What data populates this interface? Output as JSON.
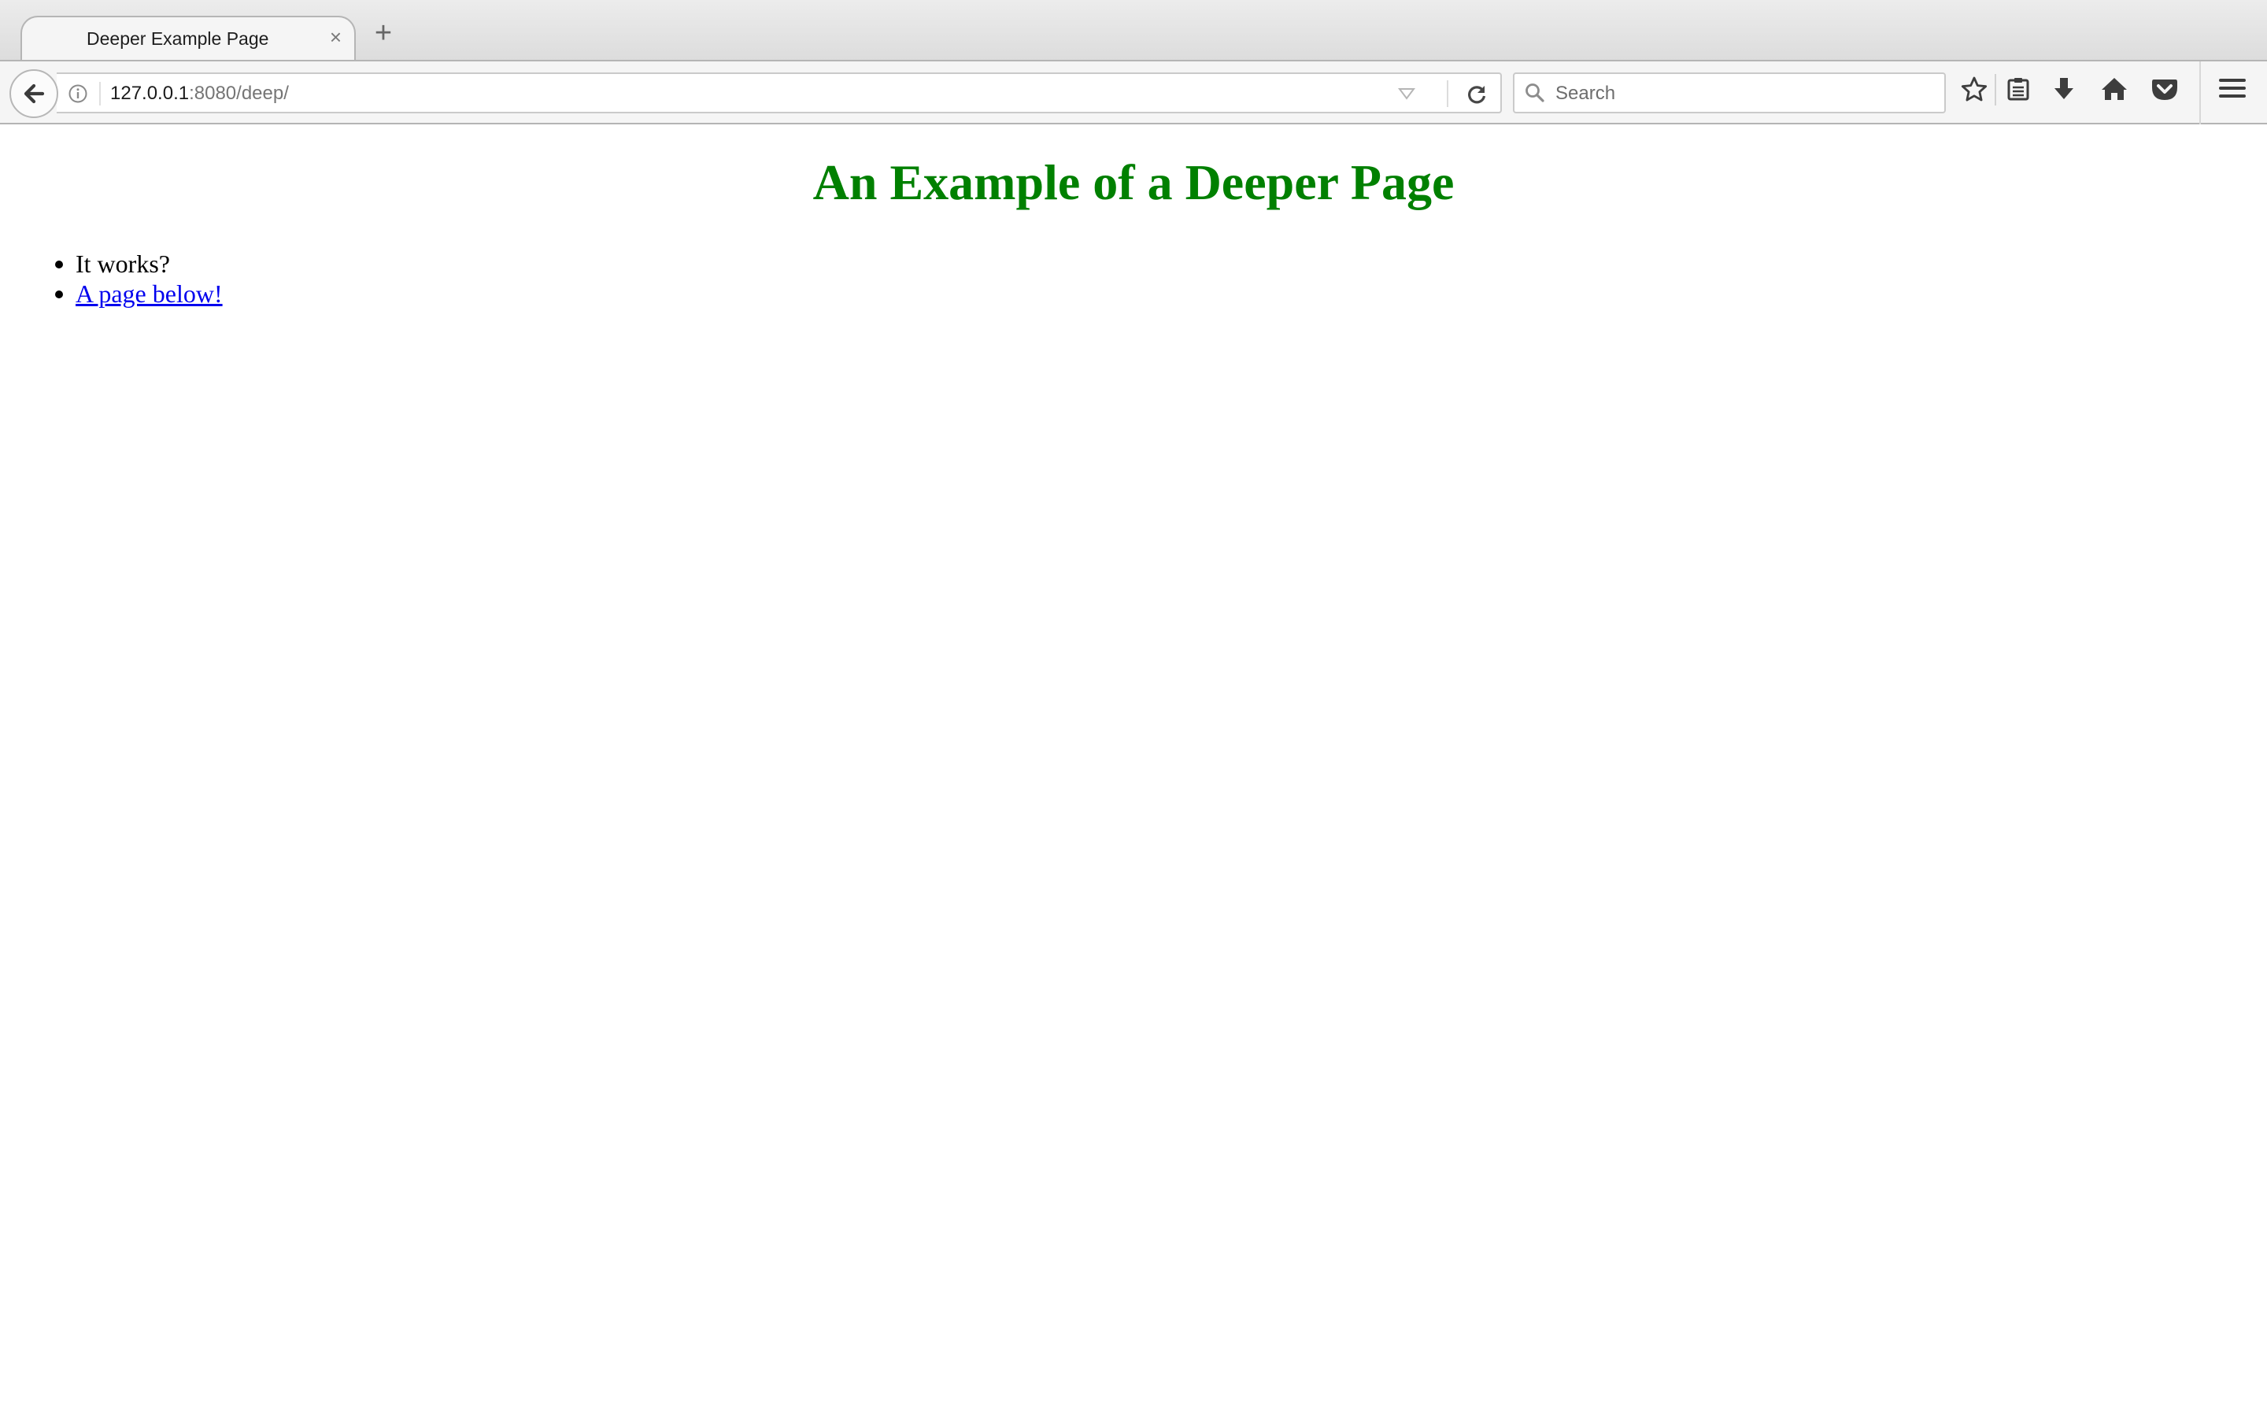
{
  "browser": {
    "tab": {
      "title": "Deeper Example Page",
      "close_symbol": "×"
    },
    "new_tab_symbol": "+",
    "address": {
      "host": "127.0.0.1",
      "rest": ":8080/deep/"
    },
    "search": {
      "placeholder": "Search"
    },
    "toolbar_icons": [
      "bookmark-star-icon",
      "reading-list-icon",
      "download-icon",
      "home-icon",
      "pocket-icon",
      "hamburger-menu-icon"
    ]
  },
  "page": {
    "heading": "An Example of a Deeper Page",
    "items": [
      {
        "text": "It works?"
      },
      {
        "text": "A page below!",
        "link": true
      }
    ],
    "colors": {
      "heading": "#008000",
      "link": "#0000ee"
    }
  }
}
